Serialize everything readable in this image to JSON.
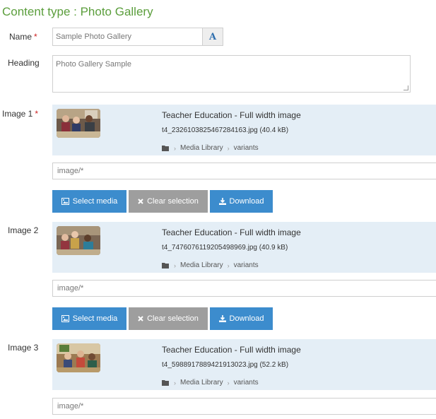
{
  "page": {
    "title": "Content type : Photo Gallery"
  },
  "form": {
    "name_label": "Name",
    "required_mark": "*",
    "name_value": "Sample Photo Gallery",
    "name_addon": "A",
    "heading_label": "Heading",
    "heading_value": "Photo Gallery Sample"
  },
  "images": [
    {
      "label": "Image 1",
      "required": "*",
      "title": "Teacher Education - Full width image",
      "file": "t4_2326103825467284163.jpg (40.4 kB)",
      "path": [
        "Media Library",
        "variants"
      ],
      "mime": "image/*",
      "buttons": {
        "select": "Select media",
        "clear": "Clear selection",
        "download": "Download"
      }
    },
    {
      "label": "Image 2",
      "title": "Teacher Education - Full width image",
      "file": "t4_7476076119205498969.jpg (40.9 kB)",
      "path": [
        "Media Library",
        "variants"
      ],
      "mime": "image/*",
      "buttons": {
        "select": "Select media",
        "clear": "Clear selection",
        "download": "Download"
      }
    },
    {
      "label": "Image 3",
      "title": "Teacher Education - Full width image",
      "file": "t4_5988917889421913023.jpg (52.2 kB)",
      "path": [
        "Media Library",
        "variants"
      ],
      "mime": "image/*"
    }
  ],
  "colors": {
    "title_green": "#5b9e3c",
    "primary_blue": "#3c8ccd",
    "disabled_gray": "#9e9e9e",
    "media_panel_bg": "#e4eef6",
    "required_red": "#cc2222"
  },
  "icons": {
    "folder": "folder-icon",
    "chevron": "chevron-right-icon",
    "image": "image-icon",
    "close": "close-icon",
    "download": "download-icon",
    "font": "font-icon"
  }
}
